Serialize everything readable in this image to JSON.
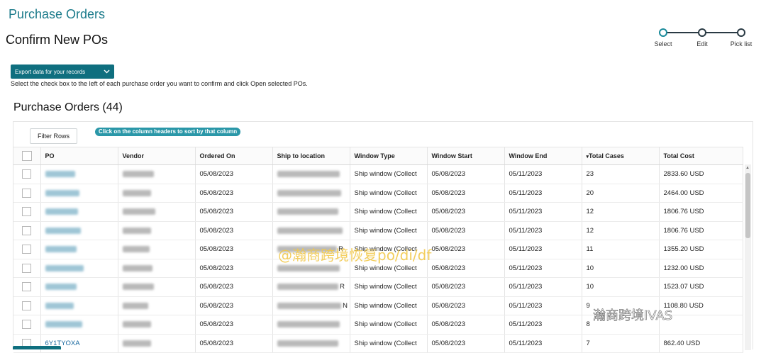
{
  "app": {
    "title": "Purchase Orders"
  },
  "page": {
    "title": "Confirm New POs"
  },
  "stepper": {
    "steps": [
      {
        "label": "Select"
      },
      {
        "label": "Edit"
      },
      {
        "label": "Pick list"
      }
    ]
  },
  "toolbar": {
    "export_label": "Export data for your records",
    "instructions": "Select the check box to the left of each purchase order you want to confirm and click Open selected POs."
  },
  "section": {
    "title": "Purchase Orders (44)"
  },
  "grid": {
    "filter_label": "Filter Rows",
    "sort_hint": "Click on the column headers to sort by that column",
    "sort_icon": "▾",
    "columns": [
      "PO",
      "Vendor",
      "Ordered On",
      "Ship to location",
      "Window Type",
      "Window Start",
      "Window End",
      "Total Cases",
      "Total Cost"
    ],
    "rows": [
      {
        "po": "",
        "ordered_on": "05/08/2023",
        "ship_suffix": "",
        "window_type": "Ship window (Collect",
        "window_start": "05/08/2023",
        "window_end": "05/11/2023",
        "total_cases": "23",
        "total_cost": "2833.60 USD"
      },
      {
        "po": "",
        "ordered_on": "05/08/2023",
        "ship_suffix": "",
        "window_type": "Ship window (Collect",
        "window_start": "05/08/2023",
        "window_end": "05/11/2023",
        "total_cases": "20",
        "total_cost": "2464.00 USD"
      },
      {
        "po": "",
        "ordered_on": "05/08/2023",
        "ship_suffix": "",
        "window_type": "Ship window (Collect",
        "window_start": "05/08/2023",
        "window_end": "05/11/2023",
        "total_cases": "12",
        "total_cost": "1806.76 USD"
      },
      {
        "po": "",
        "ordered_on": "05/08/2023",
        "ship_suffix": "",
        "window_type": "Ship window (Collect",
        "window_start": "05/08/2023",
        "window_end": "05/11/2023",
        "total_cases": "12",
        "total_cost": "1806.76 USD"
      },
      {
        "po": "",
        "ordered_on": "05/08/2023",
        "ship_suffix": "R",
        "window_type": "Ship window (Collect",
        "window_start": "05/08/2023",
        "window_end": "05/11/2023",
        "total_cases": "11",
        "total_cost": "1355.20 USD"
      },
      {
        "po": "",
        "ordered_on": "05/08/2023",
        "ship_suffix": "",
        "window_type": "Ship window (Collect",
        "window_start": "05/08/2023",
        "window_end": "05/11/2023",
        "total_cases": "10",
        "total_cost": "1232.00 USD"
      },
      {
        "po": "",
        "ordered_on": "05/08/2023",
        "ship_suffix": "R",
        "window_type": "Ship window (Collect",
        "window_start": "05/08/2023",
        "window_end": "05/11/2023",
        "total_cases": "10",
        "total_cost": "1523.07 USD"
      },
      {
        "po": "",
        "ordered_on": "05/08/2023",
        "ship_suffix": "N",
        "window_type": "Ship window (Collect",
        "window_start": "05/08/2023",
        "window_end": "05/11/2023",
        "total_cases": "9",
        "total_cost": "1108.80 USD"
      },
      {
        "po": "",
        "ordered_on": "05/08/2023",
        "ship_suffix": "",
        "window_type": "Ship window (Collect",
        "window_start": "05/08/2023",
        "window_end": "05/11/2023",
        "total_cases": "8",
        "total_cost": ""
      },
      {
        "po": "6Y1TYOXA",
        "ordered_on": "05/08/2023",
        "ship_suffix": "",
        "window_type": "Ship window (Collect",
        "window_start": "05/08/2023",
        "window_end": "05/11/2023",
        "total_cases": "7",
        "total_cost": "862.40 USD"
      }
    ]
  },
  "watermarks": {
    "center": "@瀚商跨境恢复po/di/df",
    "corner": "瀚商跨境IVAS"
  },
  "icons": {
    "dropdown": "chevron-down-icon",
    "scroll_up": "arrow-up-icon"
  },
  "colors": {
    "accent": "#0f6f7f",
    "title": "#1a7a8a",
    "badge": "#2a97a8",
    "link": "#1a6aa0"
  }
}
